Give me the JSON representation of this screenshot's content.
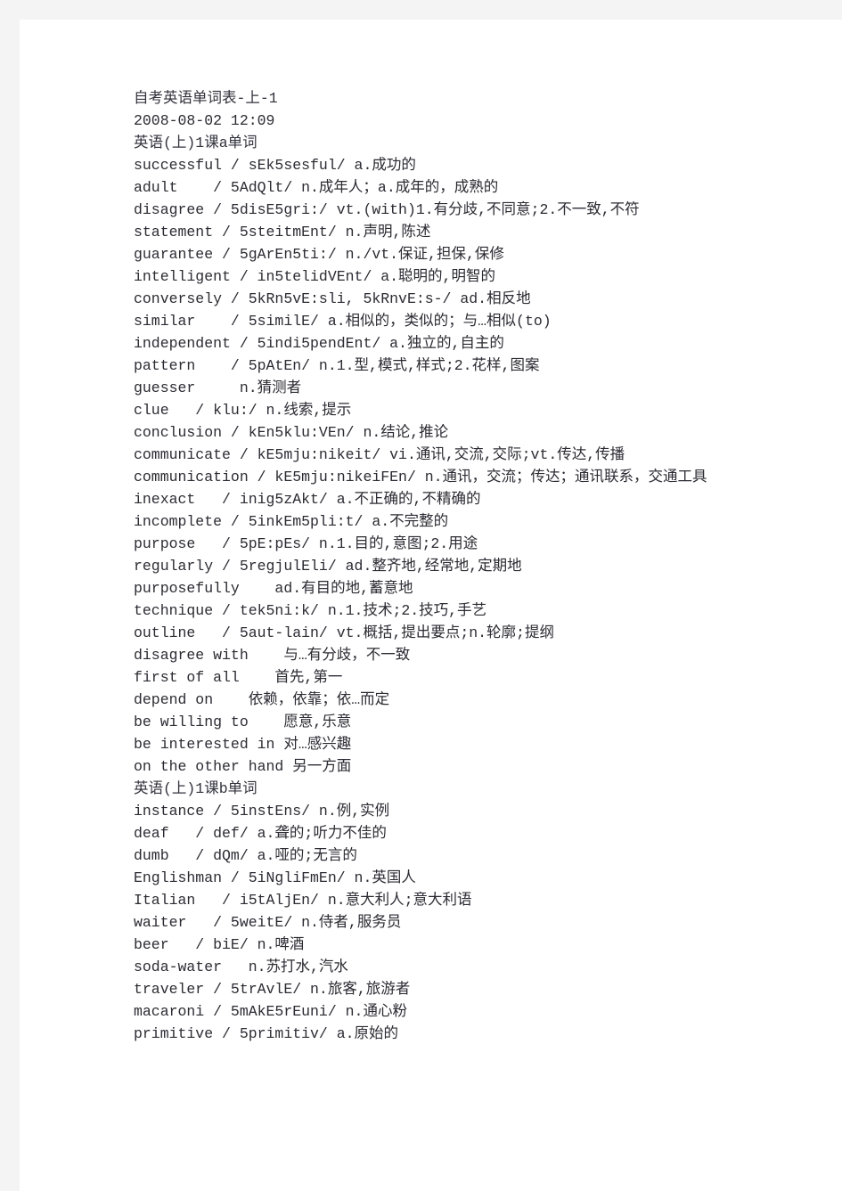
{
  "document": {
    "title": "自考英语单词表-上-1",
    "timestamp": "2008-08-02 12:09",
    "lines": [
      "自考英语单词表-上-1",
      "2008-08-02 12:09",
      "英语(上)1课a单词",
      "successful / sEk5sesful/ a.成功的",
      "adult    / 5AdQlt/ n.成年人；a.成年的，成熟的",
      "disagree / 5disE5gri:/ vt.(with)1.有分歧,不同意;2.不一致,不符",
      "statement / 5steitmEnt/ n.声明,陈述",
      "guarantee / 5gArEn5ti:/ n./vt.保证,担保,保修",
      "intelligent / in5telidVEnt/ a.聪明的,明智的",
      "conversely / 5kRn5vE:sli, 5kRnvE:s-/ ad.相反地",
      "similar    / 5similE/ a.相似的，类似的；与…相似(to)",
      "independent / 5indi5pendEnt/ a.独立的,自主的",
      "pattern    / 5pAtEn/ n.1.型,模式,样式;2.花样,图案",
      "guesser     n.猜测者",
      "clue   / klu:/ n.线索,提示",
      "conclusion / kEn5klu:VEn/ n.结论,推论",
      "communicate / kE5mju:nikeit/ vi.通讯,交流,交际;vt.传达,传播",
      "communication / kE5mju:nikeiFEn/ n.通讯，交流；传达；通讯联系，交通工具",
      "inexact   / inig5zAkt/ a.不正确的,不精确的",
      "incomplete / 5inkEm5pli:t/ a.不完整的",
      "purpose   / 5pE:pEs/ n.1.目的,意图;2.用途",
      "regularly / 5regjulEli/ ad.整齐地,经常地,定期地",
      "purposefully    ad.有目的地,蓄意地",
      "technique / tek5ni:k/ n.1.技术;2.技巧,手艺",
      "outline   / 5aut-lain/ vt.概括,提出要点;n.轮廓;提纲",
      "disagree with    与…有分歧，不一致",
      "first of all    首先,第一",
      "depend on    依赖，依靠；依…而定",
      "be willing to    愿意,乐意",
      "be interested in 对…感兴趣",
      "on the other hand 另一方面",
      "英语(上)1课b单词",
      "instance / 5instEns/ n.例,实例",
      "deaf   / def/ a.聋的;听力不佳的",
      "dumb   / dQm/ a.哑的;无言的",
      "Englishman / 5iNgliFmEn/ n.英国人",
      "Italian   / i5tAljEn/ n.意大利人;意大利语",
      "waiter   / 5weitE/ n.侍者,服务员",
      "beer   / biE/ n.啤酒",
      "soda-water   n.苏打水,汽水",
      "traveler / 5trAvlE/ n.旅客,旅游者",
      "macaroni / 5mAkE5rEuni/ n.通心粉",
      "primitive / 5primitiv/ a.原始的"
    ]
  },
  "colors": {
    "page_background": "#ffffff",
    "canvas_background": "#f4f4f4",
    "text": "#2b2b33"
  }
}
